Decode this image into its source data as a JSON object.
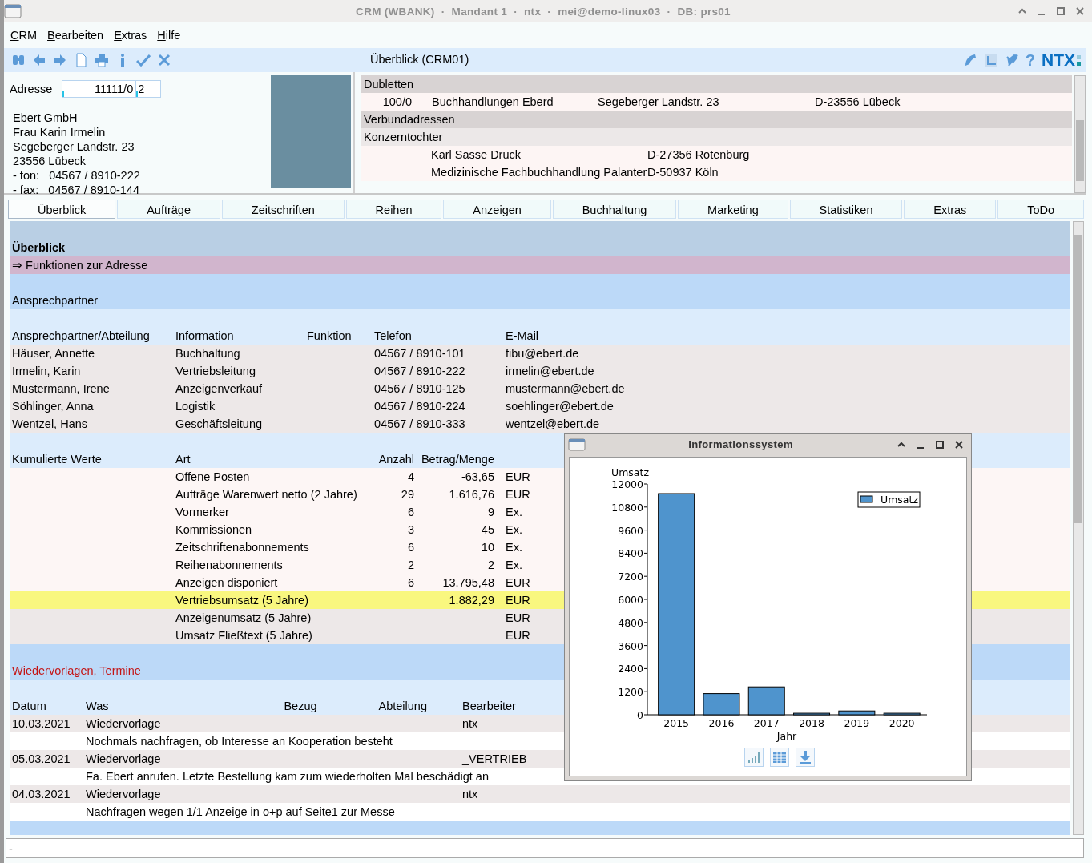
{
  "window": {
    "title": "CRM (WBANK)  ·  Mandant 1  ·  ntx  ·  mei@demo-linux03  ·  DB: prs01"
  },
  "menu": [
    "CRM",
    "Bearbeiten",
    "Extras",
    "Hilfe"
  ],
  "toolbar": {
    "title": "Überblick (CRM01)",
    "help": "?",
    "logo": "NTX"
  },
  "address": {
    "label": "Adresse",
    "number": "11111/0",
    "sub_number": "2",
    "lines": [
      "Ebert GmbH",
      "Frau Karin Irmelin",
      "Segeberger Landstr. 23",
      "23556 Lübeck",
      "- fon:   04567 / 8910-222",
      "- fax:   04567 / 8910-144"
    ]
  },
  "related": [
    {
      "kind": "group",
      "cells": [
        "Dubletten"
      ]
    },
    {
      "kind": "duplicate",
      "cells": [
        "100/0",
        "Buchhandlungen Eberd",
        "Segeberger Landstr. 23",
        "D-23556 Lübeck"
      ]
    },
    {
      "kind": "group",
      "cells": [
        "Verbundadressen"
      ]
    },
    {
      "kind": "subgroup",
      "cells": [
        "Konzerntochter"
      ]
    },
    {
      "kind": "member",
      "cells": [
        "Karl Sasse Druck",
        "D-27356 Rotenburg"
      ]
    },
    {
      "kind": "member",
      "cells": [
        "Medizinische Fachbuchhandlung Palanter",
        "D-50937 Köln"
      ]
    }
  ],
  "tabs": [
    {
      "label": "Überblick",
      "selected": true
    },
    {
      "label": "Aufträge",
      "selected": false
    },
    {
      "label": "Zeitschriften",
      "selected": false
    },
    {
      "label": "Reihen",
      "selected": false
    },
    {
      "label": "Anzeigen",
      "selected": false
    },
    {
      "label": "Buchhaltung",
      "selected": false
    },
    {
      "label": "Marketing",
      "selected": false
    },
    {
      "label": "Statistiken",
      "selected": false
    },
    {
      "label": "Extras",
      "selected": false
    },
    {
      "label": "ToDo",
      "selected": false
    }
  ],
  "overview": {
    "title": "Überblick",
    "functions_link": "⇒ Funktionen zur Adresse"
  },
  "contacts": {
    "heading": "Ansprechpartner",
    "columns": [
      "Ansprechpartner/Abteilung",
      "Information",
      "Funktion",
      "Telefon",
      "E-Mail"
    ],
    "rows": [
      [
        "Häuser, Annette",
        "Buchhaltung",
        "",
        "04567 / 8910-101",
        "fibu@ebert.de"
      ],
      [
        "Irmelin, Karin",
        "Vertriebsleitung",
        "",
        "04567 / 8910-222",
        "irmelin@ebert.de"
      ],
      [
        "Mustermann, Irene",
        "Anzeigenverkauf",
        "",
        "04567 / 8910-125",
        "mustermann@ebert.de"
      ],
      [
        "Söhlinger, Anna",
        "Logistik",
        "",
        "04567 / 8910-224",
        "soehlinger@ebert.de"
      ],
      [
        "Wentzel, Hans",
        "Geschäftsleitung",
        "",
        "04567 / 8910-333",
        "wentzel@ebert.de"
      ]
    ]
  },
  "cumulative": {
    "columns": [
      "Kumulierte Werte",
      "Art",
      "Anzahl",
      "Betrag/Menge"
    ],
    "rows": [
      {
        "kind": "count",
        "highlighted": false,
        "art": "Offene Posten",
        "count": "4",
        "amount": "-63,65",
        "unit": "EUR"
      },
      {
        "kind": "count",
        "highlighted": false,
        "art": "Aufträge Warenwert netto (2 Jahre)",
        "count": "29",
        "amount": "1.616,76",
        "unit": "EUR"
      },
      {
        "kind": "count",
        "highlighted": false,
        "art": "Vormerker",
        "count": "6",
        "amount": "9",
        "unit": "Ex."
      },
      {
        "kind": "count",
        "highlighted": false,
        "art": "Kommissionen",
        "count": "3",
        "amount": "45",
        "unit": "Ex."
      },
      {
        "kind": "count",
        "highlighted": false,
        "art": "Zeitschriftenabonnements",
        "count": "6",
        "amount": "10",
        "unit": "Ex."
      },
      {
        "kind": "count",
        "highlighted": false,
        "art": "Reihenabonnements",
        "count": "2",
        "amount": "2",
        "unit": "Ex."
      },
      {
        "kind": "count",
        "highlighted": false,
        "art": "Anzeigen disponiert",
        "count": "6",
        "amount": "13.795,48",
        "unit": "EUR"
      },
      {
        "kind": "revenue",
        "highlighted": true,
        "art": "Vertriebsumsatz (5 Jahre)",
        "amount": "1.882,29",
        "unit": "EUR"
      },
      {
        "kind": "revenue",
        "highlighted": false,
        "art": "Anzeigenumsatz (5 Jahre)",
        "unit": "EUR"
      },
      {
        "kind": "revenue",
        "highlighted": false,
        "art": "Umsatz Fließtext (5 Jahre)",
        "unit": "EUR"
      }
    ]
  },
  "followups": {
    "heading": "Wiedervorlagen, Termine",
    "columns": [
      "Datum",
      "Was",
      "Bezug",
      "Abteilung",
      "Bearbeiter"
    ],
    "rows": [
      {
        "date": "10.03.2021",
        "what": "Wiedervorlage",
        "editor": "ntx",
        "note": "Nochmals nachfragen, ob Interesse an Kooperation besteht"
      },
      {
        "date": "05.03.2021",
        "what": "Wiedervorlage",
        "editor": "_VERTRIEB",
        "note": "Fa. Ebert anrufen. Letzte Bestellung kam zum wiederholten Mal beschädigt an"
      },
      {
        "date": "04.03.2021",
        "what": "Wiedervorlage",
        "editor": "ntx",
        "note": "Nachfragen wegen 1/1 Anzeige in o+p auf Seite1 zur Messe"
      }
    ]
  },
  "status_bar": {
    "value": "-"
  },
  "info_window": {
    "title": "Informationssystem",
    "chart_data": {
      "type": "bar",
      "ylabel": "Umsatz",
      "xlabel": "Jahr",
      "categories": [
        "2015",
        "2016",
        "2017",
        "2018",
        "2019",
        "2020"
      ],
      "series": [
        {
          "name": "Umsatz",
          "color": "#4f94cd",
          "values": [
            11500,
            1100,
            1450,
            80,
            200,
            80
          ]
        }
      ],
      "ylim": [
        0,
        12000
      ],
      "yticks": [
        0,
        1200,
        2400,
        3600,
        4800,
        6000,
        7200,
        8400,
        9600,
        10800,
        12000
      ]
    }
  }
}
